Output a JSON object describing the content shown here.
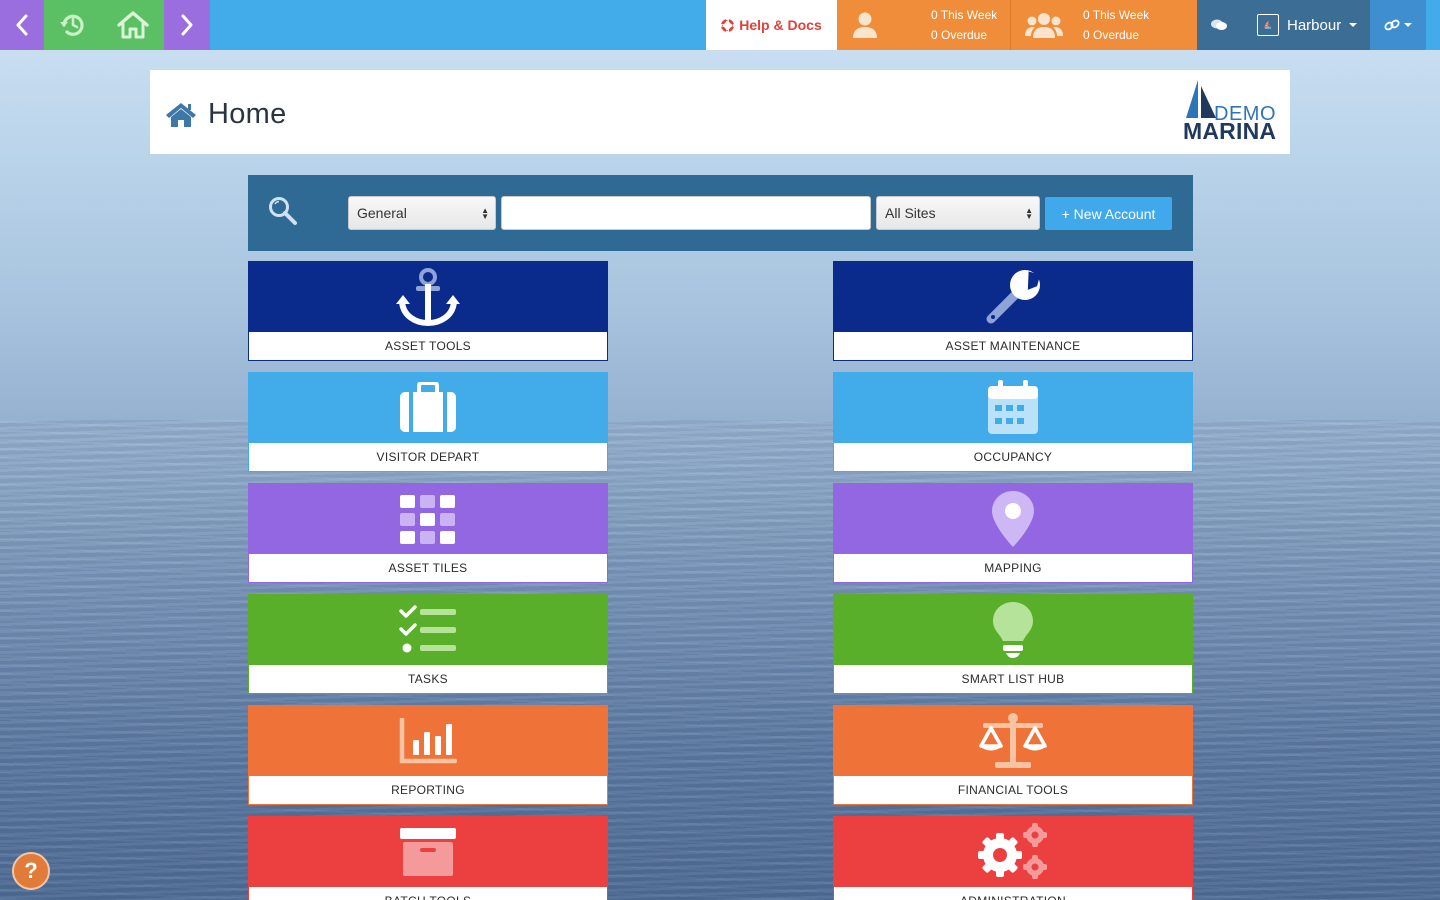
{
  "topbar": {
    "help_label": "Help & Docs",
    "my_tasks": {
      "this_week": "0 This Week",
      "overdue": "0 Overdue"
    },
    "team_tasks": {
      "this_week": "0 This Week",
      "overdue": "0 Overdue"
    },
    "site_name": "Harbour"
  },
  "header": {
    "title": "Home",
    "brand_top": "DEMO",
    "brand_bottom": "MARINA"
  },
  "search": {
    "type_value": "General",
    "query_value": "",
    "sites_value": "All Sites",
    "new_account_label": "+ New Account"
  },
  "tiles": [
    {
      "label": "ASSET TOOLS",
      "color": "#0a2a8c",
      "icon": "anchor-icon"
    },
    {
      "label": "ASSET MAINTENANCE",
      "color": "#0a2a8c",
      "icon": "wrench-icon"
    },
    {
      "label": "VISITOR DEPART",
      "color": "#42aceb",
      "icon": "suitcase-icon"
    },
    {
      "label": "OCCUPANCY",
      "color": "#42aceb",
      "icon": "calendar-icon"
    },
    {
      "label": "ASSET TILES",
      "color": "#9467e2",
      "icon": "grid-icon"
    },
    {
      "label": "MAPPING",
      "color": "#9467e2",
      "icon": "map-pin-icon"
    },
    {
      "label": "TASKS",
      "color": "#5aaf2a",
      "icon": "checklist-icon"
    },
    {
      "label": "SMART LIST HUB",
      "color": "#5aaf2a",
      "icon": "lightbulb-icon"
    },
    {
      "label": "REPORTING",
      "color": "#ef7338",
      "icon": "bar-chart-icon"
    },
    {
      "label": "FINANCIAL TOOLS",
      "color": "#ef7338",
      "icon": "scales-icon"
    },
    {
      "label": "BATCH TOOLS",
      "color": "#ec4040",
      "icon": "archive-box-icon"
    },
    {
      "label": "ADMINISTRATION",
      "color": "#ec4040",
      "icon": "cogs-icon"
    }
  ]
}
